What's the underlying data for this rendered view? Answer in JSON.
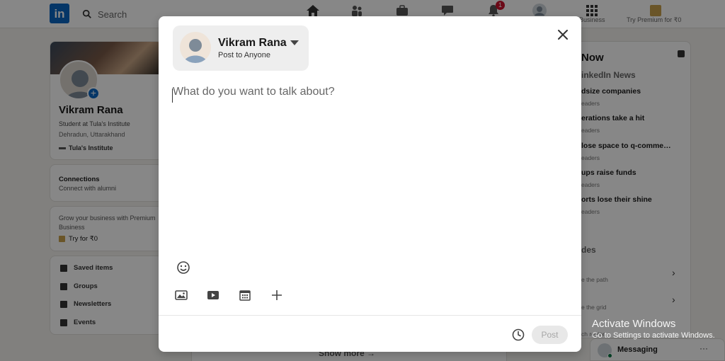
{
  "background": {
    "search_label": "Search",
    "notification_count": "1",
    "business_label": "Business",
    "premium_nav_label": "Try Premium for ₹0",
    "profile": {
      "name": "Vikram Rana",
      "headline": "Student at Tula's Institute",
      "location": "Dehradun, Uttarakhand",
      "institute": "Tula's Institute"
    },
    "connections": {
      "title": "Connections",
      "subtitle": "Connect with alumni"
    },
    "premium": {
      "line1": "Grow your business with Premium",
      "line2": "Business",
      "cta": "Try for ₹0"
    },
    "links": [
      "Saved items",
      "Groups",
      "Newsletters",
      "Events"
    ],
    "show_more": "Show more",
    "news": {
      "title": "Now",
      "subtitle": "inkedIn News",
      "items": [
        {
          "headline": "dsize companies",
          "meta": "eaders"
        },
        {
          "headline": "erations take a hit",
          "meta": "eaders"
        },
        {
          "headline": "lose space to q-comme…",
          "meta": "eaders"
        },
        {
          "headline": "ups raise funds",
          "meta": "eaders"
        },
        {
          "headline": "orts lose their shine",
          "meta": "eaders"
        }
      ],
      "section2": "des",
      "course_items": [
        "e the path",
        "e the grid",
        "ch region"
      ]
    },
    "messaging_label": "Messaging",
    "activate_line1": "Activate Windows",
    "activate_line2": "Go to Settings to activate Windows."
  },
  "modal": {
    "author_name": "Vikram Rana",
    "visibility": "Post to Anyone",
    "placeholder": "What do you want to talk about?",
    "post_button": "Post",
    "icons": {
      "emoji": "emoji-icon",
      "photo": "photo-icon",
      "video": "video-icon",
      "event": "calendar-icon",
      "more": "plus-icon",
      "schedule": "clock-icon",
      "close": "close-icon"
    }
  },
  "colors": {
    "brand": "#0a66c2",
    "overlay": "rgba(0,0,0,0.47)",
    "post_disabled_bg": "#e8e8e8",
    "post_disabled_text": "#a6a6a6"
  }
}
